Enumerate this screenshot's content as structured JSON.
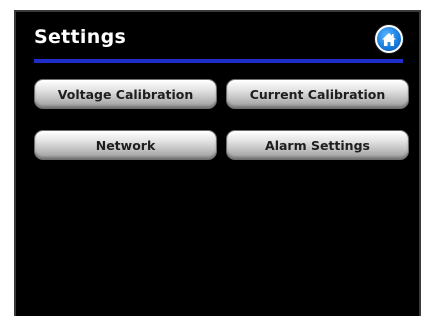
{
  "header": {
    "title": "Settings",
    "home_icon": "home-icon"
  },
  "buttons": [
    {
      "label": "Voltage Calibration"
    },
    {
      "label": "Current Calibration"
    },
    {
      "label": "Network"
    },
    {
      "label": "Alarm Settings"
    }
  ],
  "colors": {
    "background": "#000000",
    "divider": "#1f2ec8",
    "home_button": "#1b7fe0",
    "title_text": "#ffffff",
    "button_text": "#1e1e1e"
  }
}
